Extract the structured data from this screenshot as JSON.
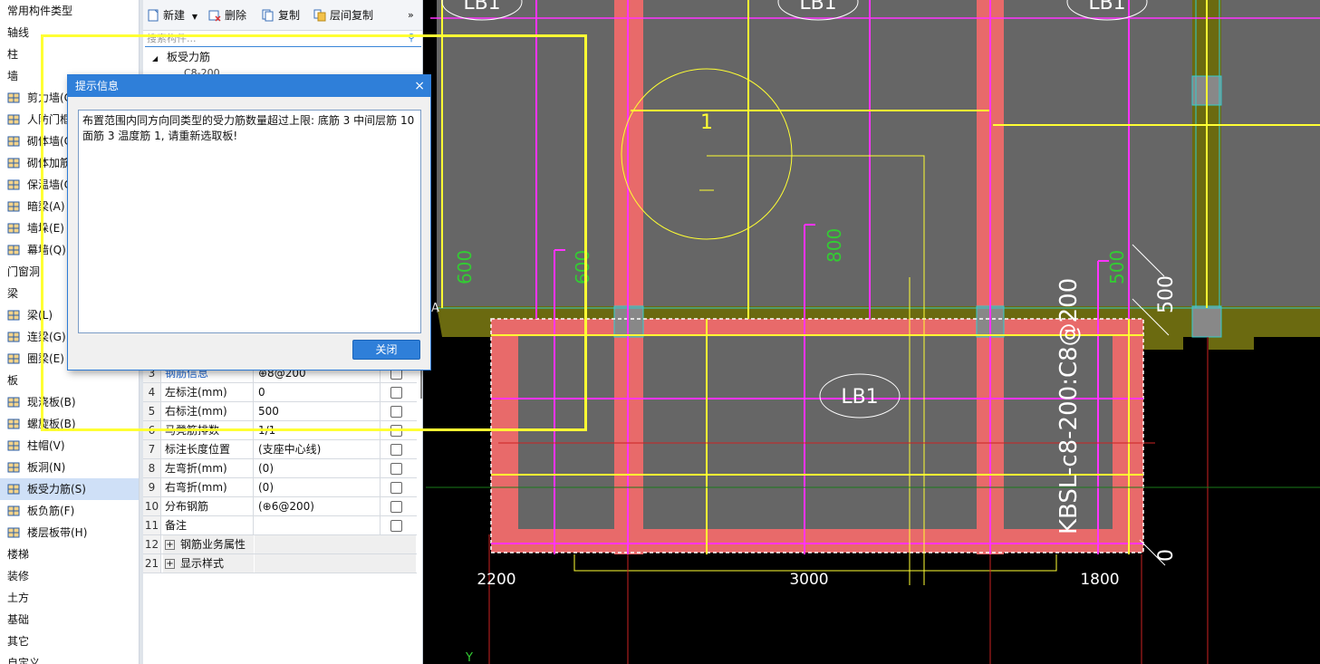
{
  "tree": {
    "items": [
      {
        "label": "常用构件类型",
        "kind": "cat"
      },
      {
        "label": "轴线",
        "kind": "cat"
      },
      {
        "label": "柱",
        "kind": "cat"
      },
      {
        "label": "墙",
        "kind": "cat"
      },
      {
        "label": "剪力墙(C",
        "kind": "sub",
        "icon": "shear-wall-icon"
      },
      {
        "label": "人防门框",
        "kind": "sub",
        "icon": "blast-door-frame-icon"
      },
      {
        "label": "砌体墙(C",
        "kind": "sub",
        "icon": "masonry-wall-icon"
      },
      {
        "label": "砌体加筋",
        "kind": "sub",
        "icon": "masonry-reinforcement-icon"
      },
      {
        "label": "保温墙(C",
        "kind": "sub",
        "icon": "insulation-wall-icon"
      },
      {
        "label": "暗梁(A)",
        "kind": "sub",
        "icon": "hidden-beam-icon"
      },
      {
        "label": "墙垛(E)",
        "kind": "sub",
        "icon": "wall-pier-icon"
      },
      {
        "label": "幕墙(Q)",
        "kind": "sub",
        "icon": "curtain-wall-icon"
      },
      {
        "label": "门窗洞",
        "kind": "cat"
      },
      {
        "label": "梁",
        "kind": "cat"
      },
      {
        "label": "梁(L)",
        "kind": "sub",
        "icon": "beam-icon"
      },
      {
        "label": "连梁(G)",
        "kind": "sub",
        "icon": "coupling-beam-icon"
      },
      {
        "label": "圈梁(E)",
        "kind": "sub",
        "icon": "ring-beam-icon"
      },
      {
        "label": "板",
        "kind": "cat"
      },
      {
        "label": "现浇板(B)",
        "kind": "sub",
        "icon": "cast-slab-icon"
      },
      {
        "label": "螺旋板(B)",
        "kind": "sub",
        "icon": "spiral-slab-icon"
      },
      {
        "label": "柱帽(V)",
        "kind": "sub",
        "icon": "column-cap-icon"
      },
      {
        "label": "板洞(N)",
        "kind": "sub",
        "icon": "slab-hole-icon"
      },
      {
        "label": "板受力筋(S)",
        "kind": "sub",
        "icon": "slab-rebar-icon",
        "selected": true
      },
      {
        "label": "板负筋(F)",
        "kind": "sub",
        "icon": "slab-negative-rebar-icon"
      },
      {
        "label": "楼层板带(H)",
        "kind": "sub",
        "icon": "floor-strip-icon"
      },
      {
        "label": "楼梯",
        "kind": "cat"
      },
      {
        "label": "装修",
        "kind": "cat"
      },
      {
        "label": "土方",
        "kind": "cat"
      },
      {
        "label": "基础",
        "kind": "cat"
      },
      {
        "label": "其它",
        "kind": "cat"
      },
      {
        "label": "自定义",
        "kind": "cat"
      }
    ]
  },
  "toolbar": {
    "new_label": "新建",
    "delete_label": "删除",
    "copy_label": "复制",
    "floor_copy_label": "层间复制",
    "more": "»"
  },
  "search": {
    "placeholder": "搜索构件..."
  },
  "component_node": {
    "label": "板受力筋",
    "child": "C8-200"
  },
  "properties": {
    "rows": [
      {
        "no": "3",
        "name": "钢筋信息",
        "value": "⊕8@200",
        "highlight": true
      },
      {
        "no": "4",
        "name": "左标注(mm)",
        "value": "0"
      },
      {
        "no": "5",
        "name": "右标注(mm)",
        "value": "500"
      },
      {
        "no": "6",
        "name": "马凳筋排数",
        "value": "1/1"
      },
      {
        "no": "7",
        "name": "标注长度位置",
        "value": "(支座中心线)"
      },
      {
        "no": "8",
        "name": "左弯折(mm)",
        "value": "(0)"
      },
      {
        "no": "9",
        "name": "右弯折(mm)",
        "value": "(0)"
      },
      {
        "no": "10",
        "name": "分布钢筋",
        "value": "(⊕6@200)"
      },
      {
        "no": "11",
        "name": "备注",
        "value": ""
      },
      {
        "no": "12",
        "name": "钢筋业务属性",
        "value": "",
        "group": true
      },
      {
        "no": "21",
        "name": "显示样式",
        "value": "",
        "group": true
      }
    ]
  },
  "dialog": {
    "title": "提示信息",
    "close": "×",
    "message": "布置范围内同方向同类型的受力筋数量超过上限: 底筋 3 中间层筋 10 面筋 3 温度筋 1, 请重新选取板!",
    "ok_label": "关闭"
  },
  "drawing": {
    "slab_labels": [
      "LB1",
      "LB1",
      "LB1",
      "LB1"
    ],
    "section_mark": "1",
    "rebar_label": "KBSL-c8-200:C8@200",
    "dims": [
      "600",
      "600",
      "800",
      "500",
      "500",
      "0",
      "2200",
      "3000",
      "1800"
    ],
    "axis_letter_a": "A",
    "axis_letter_y": "Y"
  },
  "colors": {
    "slab_gray": "#666666",
    "beam_red": "#e86a6a",
    "support_olive": "#6b6a10",
    "rebar_magenta": "#ff33ff",
    "rebar_yellow": "#ffff33",
    "dim_green": "#33cc33",
    "dialog_blue": "#2f7fd9"
  }
}
